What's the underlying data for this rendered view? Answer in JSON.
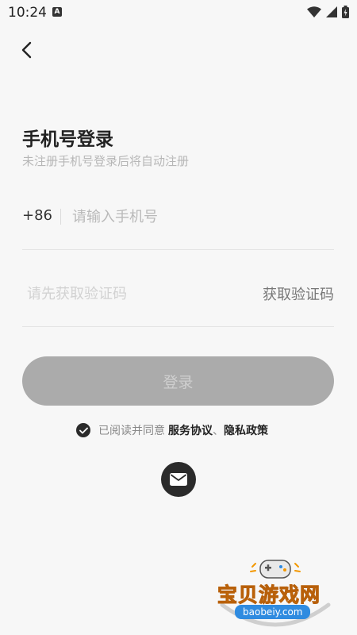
{
  "status_bar": {
    "time": "10:24",
    "notification_letter": "A"
  },
  "login": {
    "title": "手机号登录",
    "subtitle": "未注册手机号登录后将自动注册",
    "country_code": "+86",
    "phone_placeholder": "请输入手机号",
    "code_placeholder": "请先获取验证码",
    "get_code_label": "获取验证码",
    "login_button": "登录"
  },
  "agreement": {
    "prefix": "已阅读并同意",
    "service_link": "服务协议",
    "separator": "、",
    "privacy_link": "隐私政策"
  },
  "watermark": {
    "name": "宝贝游戏网",
    "url": "baobeiy.com"
  },
  "colors": {
    "login_button_bg": "#ababab",
    "login_button_text": "#cfcfcf",
    "placeholder": "#b9b9b9",
    "accent_dark": "#2b2b2b",
    "watermark_orange": "#f39800",
    "watermark_blue": "#2f8be0"
  },
  "icons": {
    "back": "back-arrow-icon",
    "check": "check-circle-icon",
    "mail": "mail-icon",
    "wifi": "wifi-icon",
    "signal": "signal-icon",
    "battery": "battery-icon"
  }
}
